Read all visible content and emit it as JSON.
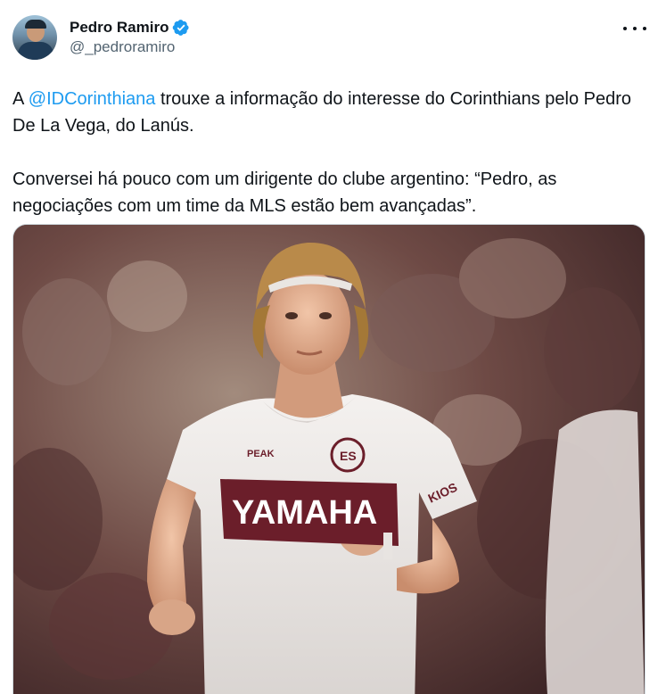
{
  "author": {
    "display_name": "Pedro Ramiro",
    "handle": "@_pedroramiro",
    "verified": true
  },
  "tweet": {
    "paragraph1": {
      "prefix": "A ",
      "mention": "@IDCorinthiana",
      "suffix": " trouxe a informação do interesse do Corinthians pelo Pedro De La Vega, do Lanús."
    },
    "paragraph2": "Conversei há pouco com um dirigente do clube argentino: “Pedro, as negociações com um time da MLS estão bem avançadas”."
  },
  "media": {
    "shirt_sponsor": "YAMAHA",
    "shirt_brand": "PEAK",
    "sleeve_sponsor": "KIOS"
  },
  "colors": {
    "link": "#1d9bf0",
    "verified": "#1d9bf0",
    "text": "#0f1419",
    "secondary": "#536471",
    "jersey_band": "#6b1e2a"
  },
  "icons": {
    "verified": "verified-badge-icon",
    "more": "more-options-icon"
  }
}
